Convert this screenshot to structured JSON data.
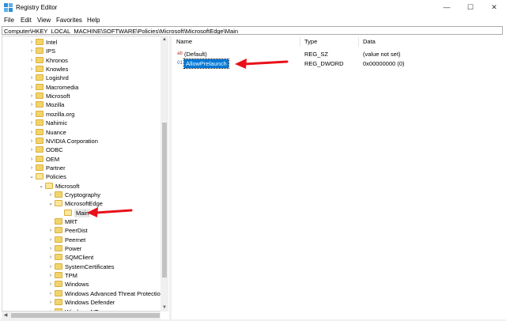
{
  "window": {
    "title": "Registry Editor",
    "minimize_glyph": "—",
    "maximize_glyph": "☐",
    "close_glyph": "✕"
  },
  "menu": [
    "File",
    "Edit",
    "View",
    "Favorites",
    "Help"
  ],
  "address": "Computer\\HKEY_LOCAL_MACHINE\\SOFTWARE\\Policies\\Microsoft\\MicrosoftEdge\\Main",
  "tree": {
    "items": [
      {
        "label": "Intel",
        "depth": 0,
        "expander": "collapsed"
      },
      {
        "label": "IPS",
        "depth": 0,
        "expander": "collapsed"
      },
      {
        "label": "Khronos",
        "depth": 0,
        "expander": "collapsed"
      },
      {
        "label": "Knowles",
        "depth": 0,
        "expander": "collapsed"
      },
      {
        "label": "Logishrd",
        "depth": 0,
        "expander": "collapsed"
      },
      {
        "label": "Macromedia",
        "depth": 0,
        "expander": "collapsed"
      },
      {
        "label": "Microsoft",
        "depth": 0,
        "expander": "collapsed"
      },
      {
        "label": "Mozilla",
        "depth": 0,
        "expander": "collapsed"
      },
      {
        "label": "mozilla.org",
        "depth": 0,
        "expander": "collapsed"
      },
      {
        "label": "Nahimic",
        "depth": 0,
        "expander": "collapsed"
      },
      {
        "label": "Nuance",
        "depth": 0,
        "expander": "collapsed"
      },
      {
        "label": "NVIDIA Corporation",
        "depth": 0,
        "expander": "collapsed"
      },
      {
        "label": "ODBC",
        "depth": 0,
        "expander": "collapsed"
      },
      {
        "label": "OEM",
        "depth": 0,
        "expander": "collapsed"
      },
      {
        "label": "Partner",
        "depth": 0,
        "expander": "collapsed"
      },
      {
        "label": "Policies",
        "depth": 0,
        "expander": "expanded"
      },
      {
        "label": "Microsoft",
        "depth": 1,
        "expander": "expanded"
      },
      {
        "label": "Cryptography",
        "depth": 2,
        "expander": "collapsed"
      },
      {
        "label": "MicrosoftEdge",
        "depth": 2,
        "expander": "expanded"
      },
      {
        "label": "Main",
        "depth": 3,
        "expander": "none",
        "selected": true
      },
      {
        "label": "MRT",
        "depth": 2,
        "expander": "none"
      },
      {
        "label": "PeerDist",
        "depth": 2,
        "expander": "collapsed"
      },
      {
        "label": "Peernet",
        "depth": 2,
        "expander": "collapsed"
      },
      {
        "label": "Power",
        "depth": 2,
        "expander": "collapsed"
      },
      {
        "label": "SQMClient",
        "depth": 2,
        "expander": "collapsed"
      },
      {
        "label": "SystemCertificates",
        "depth": 2,
        "expander": "collapsed"
      },
      {
        "label": "TPM",
        "depth": 2,
        "expander": "collapsed"
      },
      {
        "label": "Windows",
        "depth": 2,
        "expander": "collapsed"
      },
      {
        "label": "Windows Advanced Threat Protection",
        "depth": 2,
        "expander": "collapsed"
      },
      {
        "label": "Windows Defender",
        "depth": 2,
        "expander": "collapsed"
      },
      {
        "label": "Windows NT",
        "depth": 2,
        "expander": "collapsed"
      }
    ]
  },
  "list": {
    "columns": [
      "Name",
      "Type",
      "Data"
    ],
    "rows": [
      {
        "icon": "string-value-icon",
        "icon_glyph": "ab",
        "name": "(Default)",
        "type": "REG_SZ",
        "data": "(value not set)",
        "selected": false
      },
      {
        "icon": "dword-value-icon",
        "icon_glyph": "01",
        "name": "AllowPrelaunch",
        "type": "REG_DWORD",
        "data": "0x00000000 (0)",
        "selected": true
      }
    ]
  },
  "colors": {
    "accent": "#0078d7",
    "annotation_arrow": "#e8101a",
    "folder": "#f3d46b"
  }
}
